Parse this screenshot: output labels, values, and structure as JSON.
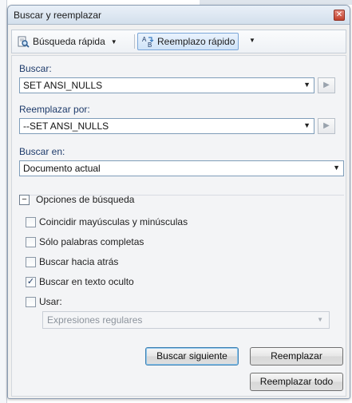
{
  "window": {
    "title": "Buscar y reemplazar"
  },
  "toolbar": {
    "quick_find_label": "Búsqueda rápida",
    "quick_replace_label": "Reemplazo rápido"
  },
  "find": {
    "label": "Buscar:",
    "value": "SET ANSI_NULLS"
  },
  "replace": {
    "label": "Reemplazar por:",
    "value": "--SET ANSI_NULLS"
  },
  "look_in": {
    "label": "Buscar en:",
    "value": "Documento actual"
  },
  "options": {
    "header": "Opciones de búsqueda",
    "collapse_symbol": "−",
    "items": [
      {
        "label": "Coincidir mayúsculas y minúsculas",
        "checked": false
      },
      {
        "label": "Sólo palabras completas",
        "checked": false
      },
      {
        "label": "Buscar hacia atrás",
        "checked": false
      },
      {
        "label": "Buscar en texto oculto",
        "checked": true
      },
      {
        "label": "Usar:",
        "checked": false
      }
    ],
    "use_select_value": "Expresiones regulares"
  },
  "buttons": {
    "find_next": "Buscar siguiente",
    "replace": "Reemplazar",
    "replace_all": "Reemplazar todo"
  },
  "icons": {
    "close": "close-icon",
    "quick_find": "binoculars-icon",
    "quick_replace": "replace-icon",
    "dropdown": "chevron-down-icon",
    "go": "play-icon"
  }
}
